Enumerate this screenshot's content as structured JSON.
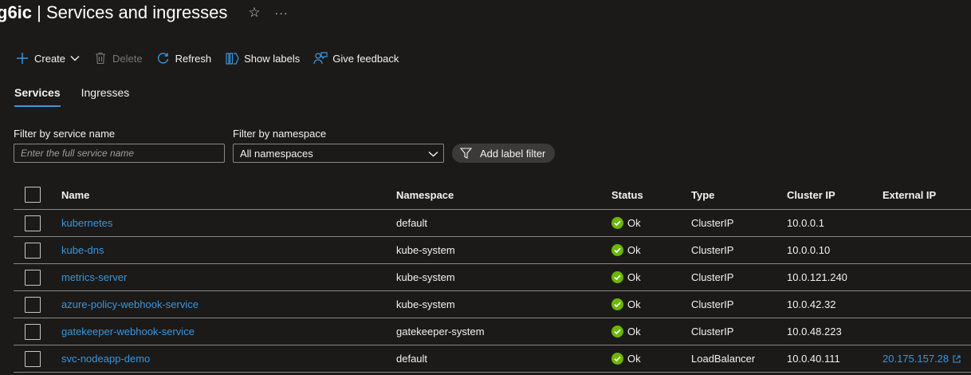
{
  "header": {
    "title_bold": "g6ic",
    "title_rest": " | Services and ingresses",
    "star_icon": "star-icon",
    "more_icon": "more-icon"
  },
  "toolbar": {
    "create": "Create",
    "delete": "Delete",
    "refresh": "Refresh",
    "show_labels": "Show labels",
    "give_feedback": "Give feedback"
  },
  "tabs": [
    {
      "label": "Services",
      "active": true
    },
    {
      "label": "Ingresses",
      "active": false
    }
  ],
  "filters": {
    "service_label": "Filter by service name",
    "service_placeholder": "Enter the full service name",
    "service_value": "",
    "namespace_label": "Filter by namespace",
    "namespace_selected": "All namespaces",
    "add_label_filter": "Add label filter"
  },
  "table": {
    "columns": {
      "name": "Name",
      "namespace": "Namespace",
      "status": "Status",
      "type": "Type",
      "cluster_ip": "Cluster IP",
      "external_ip": "External IP"
    },
    "rows": [
      {
        "name": "kubernetes",
        "namespace": "default",
        "status": "Ok",
        "type": "ClusterIP",
        "cluster_ip": "10.0.0.1",
        "external_ip": ""
      },
      {
        "name": "kube-dns",
        "namespace": "kube-system",
        "status": "Ok",
        "type": "ClusterIP",
        "cluster_ip": "10.0.0.10",
        "external_ip": ""
      },
      {
        "name": "metrics-server",
        "namespace": "kube-system",
        "status": "Ok",
        "type": "ClusterIP",
        "cluster_ip": "10.0.121.240",
        "external_ip": ""
      },
      {
        "name": "azure-policy-webhook-service",
        "namespace": "kube-system",
        "status": "Ok",
        "type": "ClusterIP",
        "cluster_ip": "10.0.42.32",
        "external_ip": ""
      },
      {
        "name": "gatekeeper-webhook-service",
        "namespace": "gatekeeper-system",
        "status": "Ok",
        "type": "ClusterIP",
        "cluster_ip": "10.0.48.223",
        "external_ip": ""
      },
      {
        "name": "svc-nodeapp-demo",
        "namespace": "default",
        "status": "Ok",
        "type": "LoadBalancer",
        "cluster_ip": "10.0.40.111",
        "external_ip": "20.175.157.28"
      }
    ]
  },
  "colors": {
    "background": "#1b1a19",
    "accent": "#3a96dd",
    "link": "#3a96dd",
    "status_ok": "#6bb700"
  }
}
